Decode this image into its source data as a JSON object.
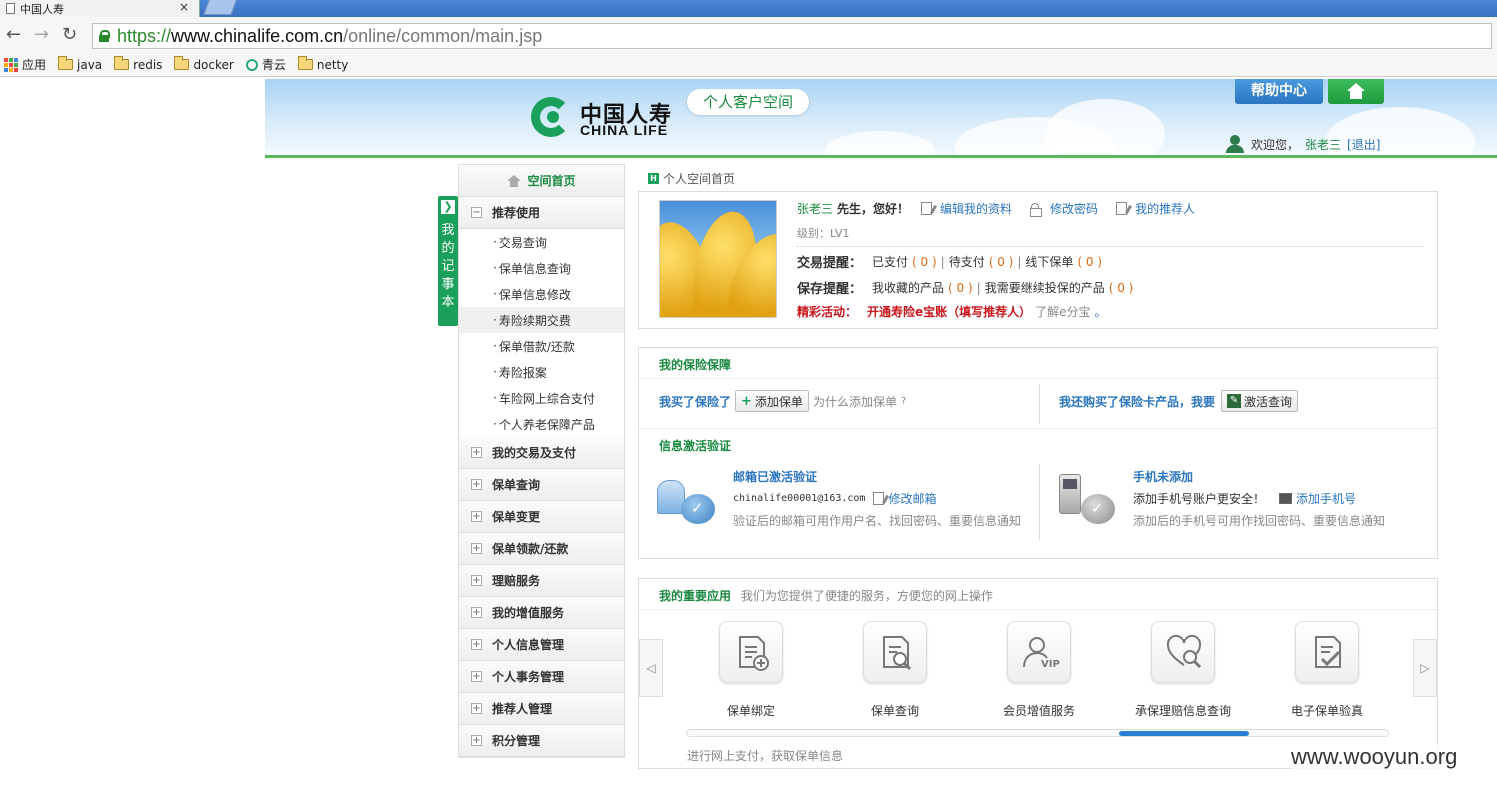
{
  "browser": {
    "tab_title": "中国人寿",
    "tab_close": "×",
    "url_scheme": "https://",
    "url_host": "www.chinalife.com.cn",
    "url_path": "/online/common/main.jsp",
    "bookmarks": [
      "应用",
      "java",
      "redis",
      "docker",
      "青云",
      "netty"
    ]
  },
  "header": {
    "logo_cn": "中国人寿",
    "logo_en": "CHINA LIFE",
    "space_label": "个人客户空间",
    "help_label": "帮助中心",
    "welcome_prefix": "欢迎您，",
    "user_name": "张老三",
    "logout": "[退出]"
  },
  "notebook": {
    "chars": [
      "我",
      "的",
      "记",
      "事",
      "本"
    ],
    "arrow": "❯"
  },
  "sidebar": {
    "home": "空间首页",
    "expanded_group": "推荐使用",
    "sub_items": [
      "交易查询",
      "保单信息查询",
      "保单信息修改",
      "寿险续期交费",
      "保单借款/还款",
      "寿险报案",
      "车险网上综合支付",
      "个人养老保障产品"
    ],
    "groups": [
      "我的交易及支付",
      "保单查询",
      "保单变更",
      "保单领款/还款",
      "理赔服务",
      "我的增值服务",
      "个人信息管理",
      "个人事务管理",
      "推荐人管理",
      "积分管理"
    ]
  },
  "breadcrumb": {
    "icon": "H",
    "text": "个人空间首页"
  },
  "profile": {
    "name": "张老三",
    "greeting": "先生，您好！",
    "edit_profile": "编辑我的资料",
    "change_password": "修改密码",
    "my_referrer": "我的推荐人",
    "level": "级别：LV1",
    "tx_label": "交易提醒：",
    "tx_paid": "已支付",
    "tx_paid_count": "( 0 )",
    "tx_pending": "待支付",
    "tx_pending_count": "( 0 )",
    "tx_offline": "线下保单",
    "tx_offline_count": "( 0 )",
    "save_label": "保存提醒：",
    "save_fav": "我收藏的产品",
    "save_fav_count": "( 0 )",
    "save_continue": "我需要继续投保的产品",
    "save_continue_count": "( 0 )",
    "event_label": "精彩活动：",
    "event_text": "开通寿险e宝账（填写推荐人）",
    "event_link": "了解e分宝",
    "event_end": "。"
  },
  "insurance": {
    "title": "我的保险保障",
    "bought": "我买了保险了",
    "add_policy": "添加保单",
    "why_add": "为什么添加保单",
    "help_glyph": "?",
    "card_text": "我还购买了保险卡产品，我要",
    "activate": "激活查询",
    "verify_title": "信息激活验证",
    "email_title": "邮箱已激活验证",
    "email_value": "chinalife00001@163.com",
    "email_modify": "修改邮箱",
    "email_note": "验证后的邮箱可用作用户名、找回密码、重要信息通知",
    "phone_title": "手机未添加",
    "phone_prompt": "添加手机号账户更安全！",
    "phone_add": "添加手机号",
    "phone_note": "添加后的手机号可用作找回密码、重要信息通知"
  },
  "apps": {
    "title": "我的重要应用",
    "subtitle": "我们为您提供了便捷的服务，方便您的网上操作",
    "prev": "◁",
    "next": "▷",
    "items": [
      {
        "label": "保单绑定",
        "icon": "policy-bind-icon"
      },
      {
        "label": "保单查询",
        "icon": "policy-search-icon"
      },
      {
        "label": "会员增值服务",
        "icon": "vip-member-icon"
      },
      {
        "label": "承保理赔信息查询",
        "icon": "claim-search-icon"
      },
      {
        "label": "电子保单验真",
        "icon": "policy-verify-icon"
      }
    ],
    "hint": "进行网上支付，获取保单信息"
  },
  "watermark": "www.wooyun.org",
  "colors": {
    "brand_green": "#1aa05a",
    "link_blue": "#2a75c0",
    "accent_orange": "#e06a10",
    "event_red": "#c8161d"
  }
}
